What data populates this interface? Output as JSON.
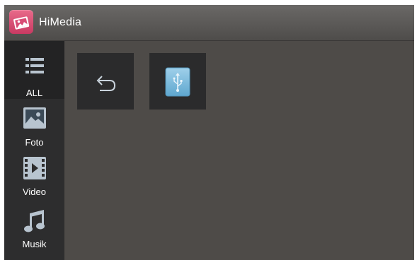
{
  "app": {
    "title": "HiMedia",
    "logo_icon": "photo-gallery-icon",
    "accent_color": "#d94c75"
  },
  "sidebar": {
    "items": [
      {
        "label": "ALL",
        "icon": "list-all-icon",
        "active": true
      },
      {
        "label": "Foto",
        "icon": "photo-icon",
        "active": false
      },
      {
        "label": "Video",
        "icon": "film-play-icon",
        "active": false
      },
      {
        "label": "Musik",
        "icon": "music-note-icon",
        "active": false
      }
    ]
  },
  "main": {
    "tiles": [
      {
        "icon": "back-arrow-icon"
      },
      {
        "icon": "usb-drive-icon"
      }
    ]
  }
}
